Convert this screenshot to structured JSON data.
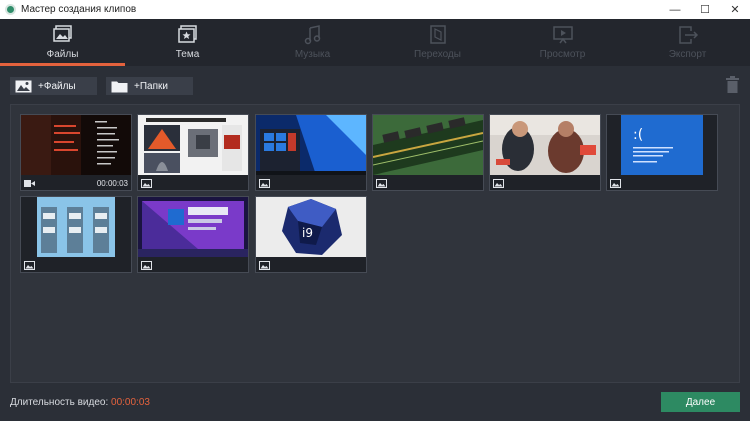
{
  "window": {
    "title": "Мастер создания клипов",
    "minimize": "—",
    "maximize": "☐",
    "close": "✕"
  },
  "tabs": [
    {
      "label": "Файлы",
      "state": "active",
      "icon": "files-icon"
    },
    {
      "label": "Тема",
      "state": "enabled",
      "icon": "theme-icon"
    },
    {
      "label": "Музыка",
      "state": "disabled",
      "icon": "music-icon"
    },
    {
      "label": "Переходы",
      "state": "disabled",
      "icon": "transitions-icon"
    },
    {
      "label": "Просмотр",
      "state": "disabled",
      "icon": "preview-icon"
    },
    {
      "label": "Экспорт",
      "state": "disabled",
      "icon": "export-icon"
    }
  ],
  "toolbar": {
    "add_files": "+Файлы",
    "add_folders": "+Папки",
    "delete_icon": "trash-icon"
  },
  "media": [
    {
      "type": "video",
      "duration": "00:00:03"
    },
    {
      "type": "image",
      "duration": ""
    },
    {
      "type": "image",
      "duration": ""
    },
    {
      "type": "image",
      "duration": ""
    },
    {
      "type": "image",
      "duration": ""
    },
    {
      "type": "image",
      "duration": ""
    },
    {
      "type": "image",
      "duration": ""
    },
    {
      "type": "image",
      "duration": ""
    },
    {
      "type": "image",
      "duration": ""
    }
  ],
  "footer": {
    "duration_label": "Длительность видео:",
    "duration_value": "00:00:03",
    "next_button": "Далее"
  },
  "colors": {
    "accent": "#e4623d",
    "next_button": "#2d8a62",
    "background": "#2b2f37",
    "tabbar": "#23262d"
  }
}
